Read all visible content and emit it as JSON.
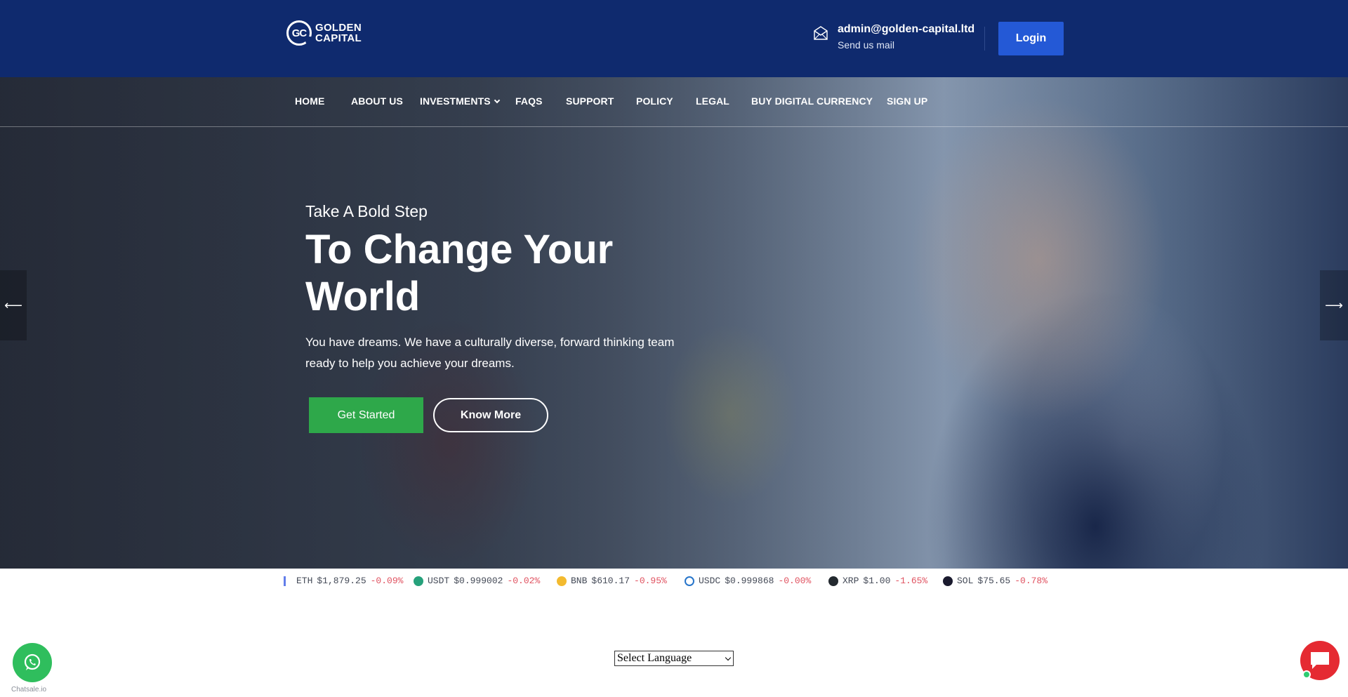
{
  "brand": {
    "logo_initials": "GC",
    "logo_line1": "GOLDEN",
    "logo_line2": "CAPITAL"
  },
  "header": {
    "email": "admin@golden-capital.ltd",
    "email_sub": "Send us mail",
    "login_label": "Login",
    "bg_color": "#0f2a6e",
    "login_color": "#2459d6"
  },
  "nav": {
    "items": [
      {
        "label": "HOME"
      },
      {
        "label": "ABOUT US"
      },
      {
        "label": "INVESTMENTS",
        "dropdown": true
      },
      {
        "label": "FAQS"
      },
      {
        "label": "SUPPORT"
      },
      {
        "label": "POLICY"
      },
      {
        "label": "LEGAL"
      },
      {
        "label": "BUY DIGITAL CURRENCY"
      },
      {
        "label": "SIGN UP"
      }
    ]
  },
  "hero": {
    "kicker": "Take A Bold Step",
    "title": "To Change Your World",
    "subtitle": "You have dreams. We have a culturally diverse, forward thinking team ready to help you achieve your dreams.",
    "primary_button": "Get Started",
    "secondary_button": "Know More",
    "prev_arrow": "⟵",
    "next_arrow": "⟶",
    "primary_color": "#2ea84a"
  },
  "ticker": {
    "items": [
      {
        "symbol": "ETH",
        "price": "$1,879.25",
        "change": "-0.09%",
        "icon": "eth-icon",
        "color": "#627eea"
      },
      {
        "symbol": "USDT",
        "price": "$0.999002",
        "change": "-0.02%",
        "icon": "usdt-icon",
        "color": "#26a17b"
      },
      {
        "symbol": "BNB",
        "price": "$610.17",
        "change": "-0.95%",
        "icon": "bnb-icon",
        "color": "#f3ba2f"
      },
      {
        "symbol": "USDC",
        "price": "$0.999868",
        "change": "-0.00%",
        "icon": "usdc-icon",
        "color": "#2775ca"
      },
      {
        "symbol": "XRP",
        "price": "$1.00",
        "change": "-1.65%",
        "icon": "xrp-icon",
        "color": "#23292f"
      },
      {
        "symbol": "SOL",
        "price": "$75.65",
        "change": "-0.78%",
        "icon": "sol-icon",
        "color": "#1a1a2e"
      }
    ]
  },
  "footer": {
    "language_select": "Select Language",
    "whatsapp_label": "Chatsale.io"
  }
}
